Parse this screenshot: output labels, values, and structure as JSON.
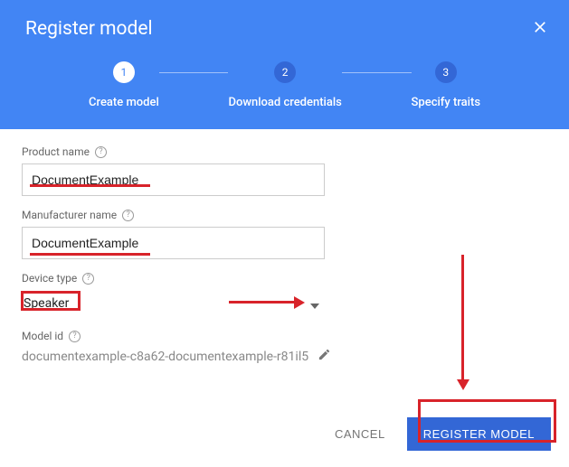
{
  "dialog": {
    "title": "Register model"
  },
  "stepper": {
    "steps": [
      {
        "num": "1",
        "label": "Create model",
        "active": true
      },
      {
        "num": "2",
        "label": "Download credentials",
        "active": false
      },
      {
        "num": "3",
        "label": "Specify traits",
        "active": false
      }
    ]
  },
  "form": {
    "product_name": {
      "label": "Product name",
      "value": "DocumentExample"
    },
    "manufacturer_name": {
      "label": "Manufacturer name",
      "value": "DocumentExample"
    },
    "device_type": {
      "label": "Device type",
      "value": "Speaker"
    },
    "model_id": {
      "label": "Model id",
      "value": "documentexample-c8a62-documentexample-r81il5"
    }
  },
  "actions": {
    "cancel": "CANCEL",
    "submit": "REGISTER MODEL"
  },
  "annotation_color": "#d8232a"
}
